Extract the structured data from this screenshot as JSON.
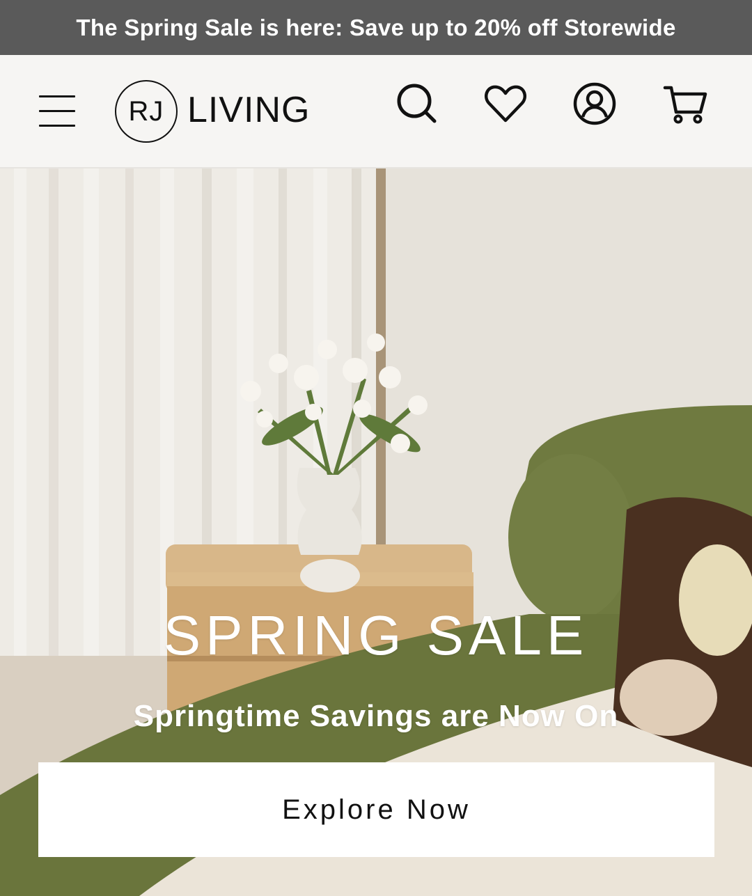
{
  "announcement": {
    "text": "The Spring Sale is here: Save up to 20% off Storewide"
  },
  "header": {
    "logo_mark": "RJ",
    "logo_text": "LIVING",
    "icons": [
      "menu-icon",
      "search-icon",
      "heart-icon",
      "account-icon",
      "cart-icon"
    ]
  },
  "hero": {
    "title": "SPRING SALE",
    "subtitle": "Springtime Savings are Now On",
    "cta_label": "Explore Now"
  },
  "colors": {
    "announcement_bg": "#5a5a5a",
    "header_bg": "#f6f5f3",
    "sofa_green": "#6f7a40",
    "cta_bg": "#ffffff",
    "text_dark": "#111111"
  }
}
